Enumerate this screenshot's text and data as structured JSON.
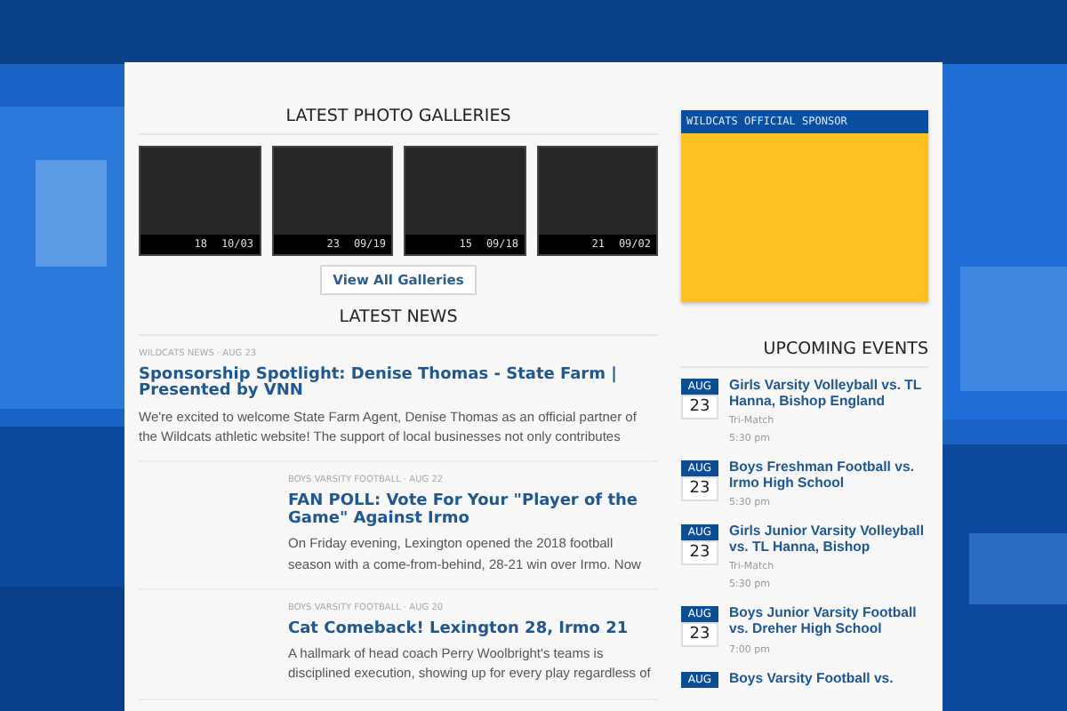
{
  "galleries": {
    "title": "LATEST PHOTO GALLERIES",
    "items": [
      {
        "count": "18",
        "date": "10/03"
      },
      {
        "count": "23",
        "date": "09/19"
      },
      {
        "count": "15",
        "date": "09/18"
      },
      {
        "count": "21",
        "date": "09/02"
      }
    ],
    "button": "View All Galleries"
  },
  "news": {
    "title": "LATEST NEWS",
    "items": [
      {
        "kind": "full",
        "meta": "WILDCATS NEWS · AUG 23",
        "title": "Sponsorship Spotlight: Denise Thomas - State Farm | Presented by VNN",
        "excerpt": "We're excited to welcome State Farm Agent, Denise Thomas as an official partner of the Wildcats athletic website! The support of local businesses not only contributes"
      },
      {
        "kind": "indented",
        "meta": "BOYS VARSITY FOOTBALL · AUG 22",
        "title": "FAN POLL: Vote For Your \"Player of the Game\" Against Irmo",
        "excerpt": "On Friday evening, Lexington opened the 2018 football season with a come-from-behind, 28-21 win over Irmo.  Now"
      },
      {
        "kind": "indented",
        "meta": "BOYS VARSITY FOOTBALL · AUG 20",
        "title": "Cat Comeback! Lexington 28, Irmo 21",
        "excerpt": "A hallmark of head coach Perry Woolbright's teams is disciplined execution, showing up for every play regardless of"
      }
    ]
  },
  "sponsor": {
    "title": "WILDCATS OFFICIAL SPONSOR"
  },
  "events": {
    "title": "UPCOMING EVENTS",
    "items": [
      {
        "month": "AUG",
        "day": "23",
        "title": "Girls Varsity Volleyball vs. TL Hanna, Bishop England",
        "note": "Tri-Match",
        "time": "5:30 pm"
      },
      {
        "month": "AUG",
        "day": "23",
        "title": "Boys Freshman Football vs. Irmo High School",
        "time": "5:30 pm"
      },
      {
        "month": "AUG",
        "day": "23",
        "title": "Girls Junior Varsity Volleyball vs. TL Hanna, Bishop",
        "note": "Tri-Match",
        "time": "5:30 pm"
      },
      {
        "month": "AUG",
        "day": "23",
        "title": "Boys Junior Varsity Football vs. Dreher High School",
        "time": "7:00 pm"
      },
      {
        "month": "AUG",
        "title": "Boys Varsity Football vs."
      }
    ]
  }
}
